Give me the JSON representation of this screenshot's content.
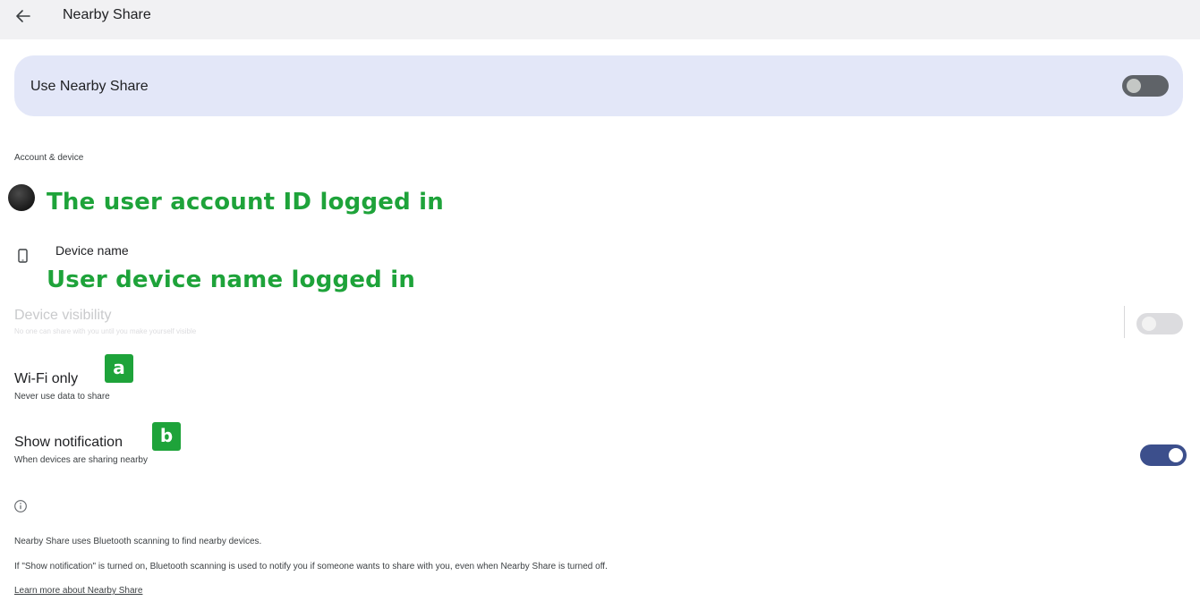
{
  "header": {
    "back_icon": "arrow-back-icon",
    "title": "Nearby Share"
  },
  "use_nearby": {
    "label": "Use Nearby Share",
    "enabled": false
  },
  "account_section": {
    "label": "Account & device",
    "account_overlay": "The user account ID logged in",
    "device_name_label": "Device name",
    "device_overlay": "User device name logged in",
    "device_icon": "phone-icon",
    "avatar_icon": "avatar"
  },
  "device_visibility": {
    "title": "Device visibility",
    "subtitle": "No one can share with you until you make yourself visible",
    "enabled": false,
    "disabled": true
  },
  "wifi_only": {
    "title": "Wi-Fi only",
    "subtitle": "Never use data to share",
    "badge": "a"
  },
  "show_notification": {
    "title": "Show notification",
    "subtitle": "When devices are sharing nearby",
    "badge": "b",
    "enabled": true
  },
  "info": {
    "icon": "info-icon",
    "line1": "Nearby Share uses Bluetooth scanning to find nearby devices.",
    "line2": "If \"Show notification\" is turned on, Bluetooth scanning is used to notify you if someone wants to share with you, even when Nearby Share is turned off.",
    "link": "Learn more about Nearby Share"
  },
  "colors": {
    "card_bg": "#e3e7f8",
    "toggle_on": "#3c4f8c",
    "toggle_off": "#5f6368",
    "annotation_green": "#1ea33a",
    "topbar_bg": "#f1f1f3"
  }
}
